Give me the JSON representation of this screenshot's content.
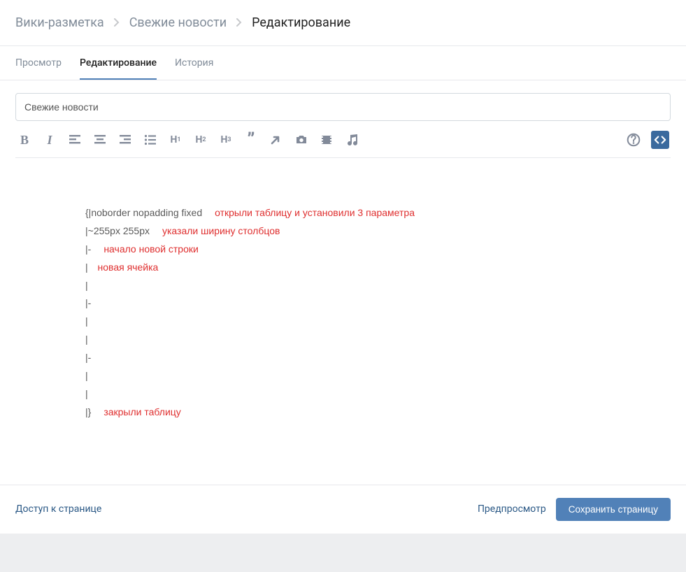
{
  "breadcrumbs": {
    "items": [
      {
        "label": "Вики-разметка"
      },
      {
        "label": "Свежие новости"
      }
    ],
    "current": "Редактирование"
  },
  "tabs": {
    "view": {
      "label": "Просмотр"
    },
    "edit": {
      "label": "Редактирование"
    },
    "history": {
      "label": "История"
    }
  },
  "title_field": {
    "value": "Свежие новости"
  },
  "toolbar": {
    "bold": "bold",
    "italic": "italic",
    "align_left": "align-left",
    "align_center": "align-center",
    "align_right": "align-right",
    "list": "bulleted-list",
    "h1": "H₁",
    "h2": "H₂",
    "h3": "H₃",
    "quote": "quote",
    "link": "insert-link",
    "photo": "photo",
    "video": "video",
    "audio": "audio",
    "info": "help",
    "code": "wiki-markup"
  },
  "content": {
    "lines": [
      {
        "code": "{|noborder nopadding fixed",
        "ann": "открыли таблицу и установили 3 параметра"
      },
      {
        "code": "|~255px 255px",
        "ann": "указали ширину столбцов"
      },
      {
        "code": "|-",
        "ann": "начало новой строки"
      },
      {
        "code": "| ",
        "ann": "новая ячейка",
        "tight": true
      },
      {
        "code": "|"
      },
      {
        "code": "|-"
      },
      {
        "code": "|"
      },
      {
        "code": "|"
      },
      {
        "code": "|-"
      },
      {
        "code": "|"
      },
      {
        "code": "|"
      },
      {
        "code": "|}",
        "ann": "закрыли таблицу"
      }
    ]
  },
  "footer": {
    "access": "Доступ к странице",
    "preview": "Предпросмотр",
    "save": "Сохранить страницу"
  }
}
